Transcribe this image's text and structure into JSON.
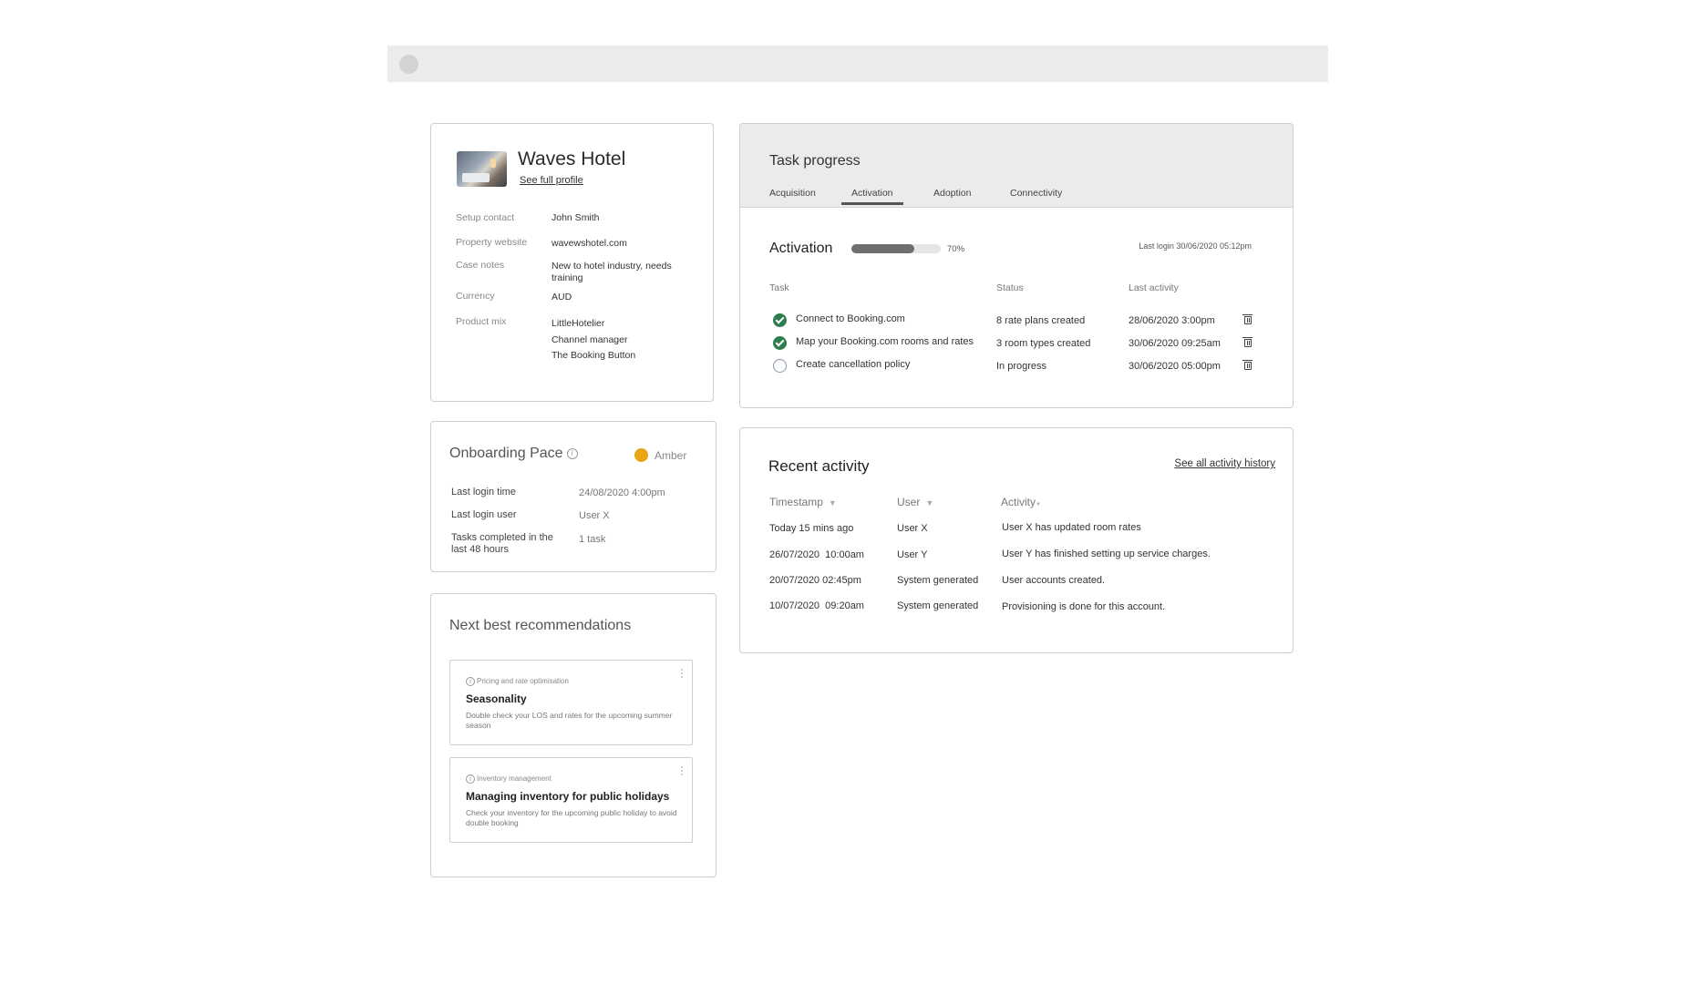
{
  "hotel": {
    "name": "Waves Hotel",
    "profile_link": "See full profile",
    "fields": [
      {
        "label": "Setup contact",
        "value": "John Smith"
      },
      {
        "label": "Property website",
        "value": "wavewshotel.com"
      },
      {
        "label": "Case notes",
        "value": "New to hotel industry, needs training"
      },
      {
        "label": "Currency",
        "value": "AUD"
      }
    ],
    "product_mix_label": "Product mix",
    "product_mix": [
      "LittleHotelier",
      "Channel manager",
      "The Booking Button"
    ]
  },
  "pace": {
    "title": "Onboarding Pace",
    "status": "Amber",
    "status_color": "#e8a514",
    "rows": [
      {
        "label": "Last login time",
        "value": "24/08/2020 4:00pm"
      },
      {
        "label": "Last login user",
        "value": "User X"
      },
      {
        "label": "Tasks completed in the last 48 hours",
        "value": "1 task"
      }
    ]
  },
  "recommendations": {
    "title": "Next best recommendations",
    "items": [
      {
        "category": "Pricing and rate optimisation",
        "name": "Seasonality",
        "description": "Double check your LOS and rates for the upcoming summer season"
      },
      {
        "category": "Inventory management",
        "name": "Managing inventory for public holidays",
        "description": "Check your inventory for the upcoming public holiday to avoid double booking"
      }
    ]
  },
  "task_progress": {
    "title": "Task progress",
    "tabs": [
      "Acquisition",
      "Activation",
      "Adoption",
      "Connectivity"
    ],
    "active_tab": "Activation",
    "section_title": "Activation",
    "progress": 70,
    "progress_label": "70%",
    "last_login": "Last login 30/06/2020 05:12pm",
    "columns": [
      "Task",
      "Status",
      "Last activity"
    ],
    "rows": [
      {
        "done": true,
        "task": "Connect to Booking.com",
        "status": "8 rate plans created",
        "last_activity": "28/06/2020 3:00pm"
      },
      {
        "done": true,
        "task": "Map your Booking.com rooms and rates",
        "status": "3 room types created",
        "last_activity": "30/06/2020 09:25am"
      },
      {
        "done": false,
        "task": "Create cancellation policy",
        "status": "In progress",
        "last_activity": "30/06/2020 05:00pm"
      }
    ]
  },
  "activity": {
    "title": "Recent activity",
    "link": "See all activity history",
    "columns": [
      "Timestamp",
      "User",
      "Activity"
    ],
    "rows": [
      {
        "timestamp": "Today 15 mins ago",
        "user": "User X",
        "activity": "User X has updated room rates"
      },
      {
        "timestamp": "26/07/2020  10:00am",
        "user": "User Y",
        "activity": "User Y has finished setting up service charges."
      },
      {
        "timestamp": "20/07/2020 02:45pm",
        "user": "System generated",
        "activity": "User accounts created."
      },
      {
        "timestamp": "10/07/2020  09:20am",
        "user": "System generated",
        "activity": "Provisioning is done for this account."
      }
    ]
  }
}
